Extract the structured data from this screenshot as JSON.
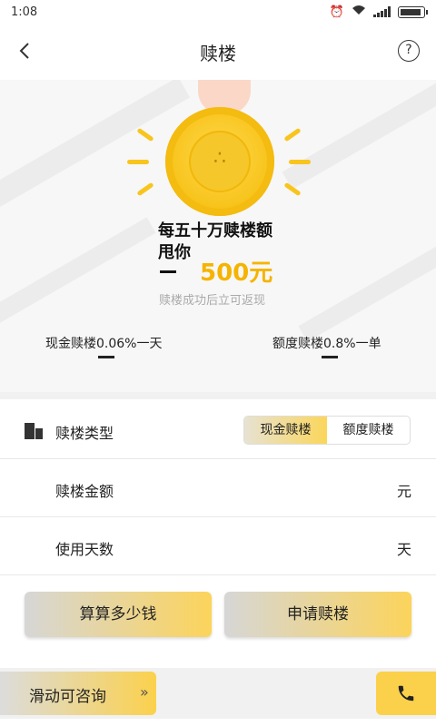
{
  "status_bar": {
    "time": "1:08"
  },
  "header": {
    "back_icon": "chevron-left-icon",
    "title": "赎楼",
    "help_icon": "question-circle-icon"
  },
  "promo": {
    "line1": "每五十万赎楼额",
    "line2": "甩你",
    "amount": "500元",
    "subtitle": "赎楼成功后立可返现"
  },
  "rates": {
    "cash": "现金赎楼0.06%一天",
    "quota": "额度赎楼0.8%一单"
  },
  "form": {
    "type_label": "赎楼类型",
    "type_options": [
      "现金赎楼",
      "额度赎楼"
    ],
    "type_selected": "现金赎楼",
    "amount_label": "赎楼金额",
    "amount_unit": "元",
    "days_label": "使用天数",
    "days_unit": "天"
  },
  "actions": {
    "calc_label": "算算多少钱",
    "apply_label": "申请赎楼"
  },
  "footer": {
    "consult_label": "滑动可咨询",
    "arrows": "»",
    "phone_icon": "phone-icon"
  },
  "colors": {
    "accent": "#fbd14c",
    "amount": "#f5b400"
  }
}
